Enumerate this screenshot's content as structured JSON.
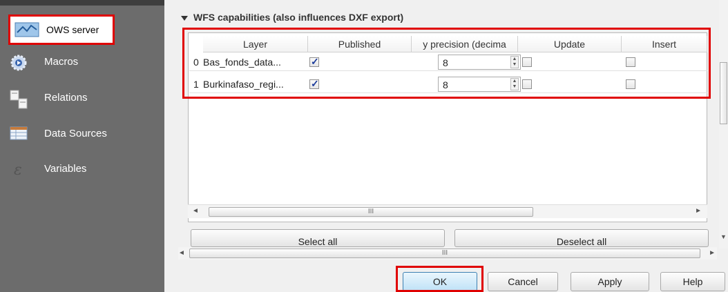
{
  "sidebar": {
    "items": [
      {
        "label": "OWS server",
        "icon": "ows-server-icon"
      },
      {
        "label": "Macros",
        "icon": "macros-gear-icon"
      },
      {
        "label": "Relations",
        "icon": "relations-icon"
      },
      {
        "label": "Data Sources",
        "icon": "data-sources-icon"
      },
      {
        "label": "Variables",
        "icon": "variables-icon"
      }
    ],
    "selected": "OWS server"
  },
  "section": {
    "title": "WFS capabilities (also influences DXF export)",
    "expanded": true
  },
  "table": {
    "headers": [
      "Layer",
      "Published",
      "y precision (decima",
      "Update",
      "Insert"
    ],
    "rows": [
      {
        "index": "0",
        "layer": "Bas_fonds_data...",
        "published": true,
        "precision": "8",
        "update": false,
        "insert": false
      },
      {
        "index": "1",
        "layer": "Burkinafaso_regi...",
        "published": true,
        "precision": "8",
        "update": false,
        "insert": false
      }
    ]
  },
  "scroll_thumb_mark": "III",
  "buttons": {
    "select_all": "Select all",
    "deselect_all": "Deselect all",
    "ok": "OK",
    "cancel": "Cancel",
    "apply": "Apply",
    "help": "Help"
  },
  "colors": {
    "highlight": "#e00000",
    "sidebar": "#6c6c6c"
  }
}
